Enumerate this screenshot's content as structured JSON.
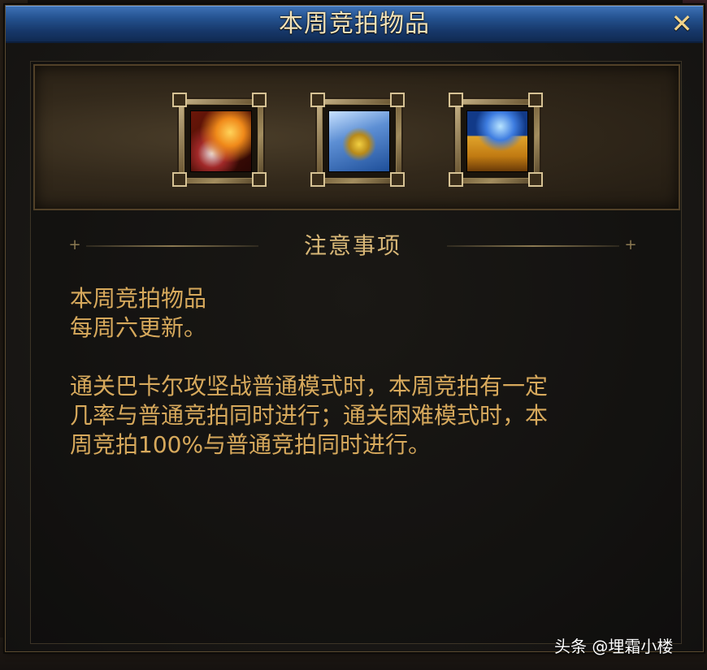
{
  "window": {
    "title": "本周竞拍物品",
    "close_label": "✕"
  },
  "items": [
    {
      "name": "flame-relic-icon"
    },
    {
      "name": "gold-ticket-icon"
    },
    {
      "name": "treasure-chest-icon"
    }
  ],
  "notice": {
    "heading": "注意事项",
    "line1": "本周竞拍物品",
    "line2": "每周六更新。",
    "line3": "通关巴卡尔攻坚战普通模式时，本周竞拍有一定",
    "line4": "几率与普通竞拍同时进行；通关困难模式时，本",
    "line5": "周竞拍100%与普通竞拍同时进行。"
  },
  "watermark": "头条 @埋霜小楼",
  "colors": {
    "title_bar": "#24528f",
    "title_text": "#f2e2b8",
    "body_text": "#d7a95c",
    "heading_text": "#d8b777"
  }
}
